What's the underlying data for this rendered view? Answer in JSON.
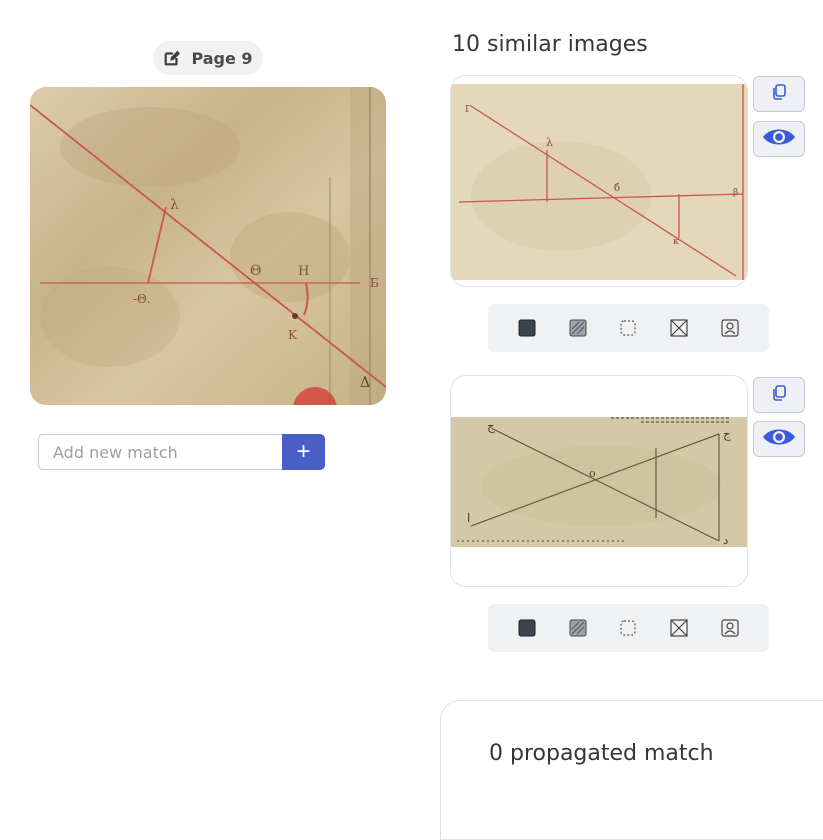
{
  "page_tag": {
    "label": "Page 9",
    "icon": "edit-icon"
  },
  "new_match": {
    "placeholder": "Add new match",
    "add_label": "+"
  },
  "similar": {
    "heading": "10 similar images",
    "results": [
      {
        "actions": [
          "copy-icon",
          "eye-icon"
        ]
      },
      {
        "actions": [
          "copy-icon",
          "eye-icon"
        ]
      }
    ],
    "tools": [
      "filled-square-icon",
      "hatched-square-icon",
      "dotted-square-icon",
      "crossed-square-icon",
      "user-square-icon"
    ]
  },
  "propagated": {
    "label": "0 propagated match"
  },
  "colors": {
    "accent": "#485fc7",
    "eye": "#3b5bdb",
    "diagram_red": "#c9574e"
  }
}
